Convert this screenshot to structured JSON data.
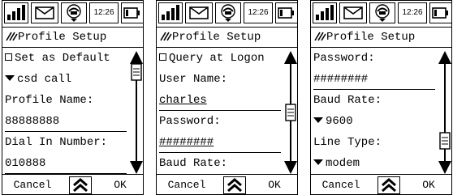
{
  "screens": [
    {
      "status": {
        "time": "12:26"
      },
      "title": "Profile Setup",
      "rows": [
        {
          "kind": "checkbox",
          "label": "Set as Default"
        },
        {
          "kind": "dropdown",
          "label": "csd call"
        },
        {
          "kind": "label",
          "label": "Profile Name:"
        },
        {
          "kind": "value",
          "label": "88888888"
        },
        {
          "kind": "label",
          "label": "Dial In Number:"
        },
        {
          "kind": "value",
          "label": "010888"
        }
      ],
      "scroll_position": 0.0,
      "footer": {
        "cancel": "Cancel",
        "ok": "OK"
      }
    },
    {
      "status": {
        "time": "12:26"
      },
      "title": "Profile Setup",
      "rows": [
        {
          "kind": "checkbox",
          "label": "Query at Logon"
        },
        {
          "kind": "label",
          "label": "User Name:"
        },
        {
          "kind": "value",
          "label": "charles",
          "underline": true
        },
        {
          "kind": "label",
          "label": "Password:"
        },
        {
          "kind": "value",
          "label": "########",
          "underline": true
        },
        {
          "kind": "label",
          "label": "Baud Rate:"
        }
      ],
      "scroll_position": 0.5,
      "footer": {
        "cancel": "Cancel",
        "ok": "OK"
      }
    },
    {
      "status": {
        "time": "12:26"
      },
      "title": "Profile Setup",
      "rows": [
        {
          "kind": "label",
          "label": "Password:"
        },
        {
          "kind": "value",
          "label": "########"
        },
        {
          "kind": "label",
          "label": "Baud Rate:"
        },
        {
          "kind": "dropdown",
          "label": "9600"
        },
        {
          "kind": "label",
          "label": "Line Type:"
        },
        {
          "kind": "dropdown",
          "label": "modem"
        }
      ],
      "scroll_position": 0.85,
      "footer": {
        "cancel": "Cancel",
        "ok": "OK"
      }
    }
  ]
}
